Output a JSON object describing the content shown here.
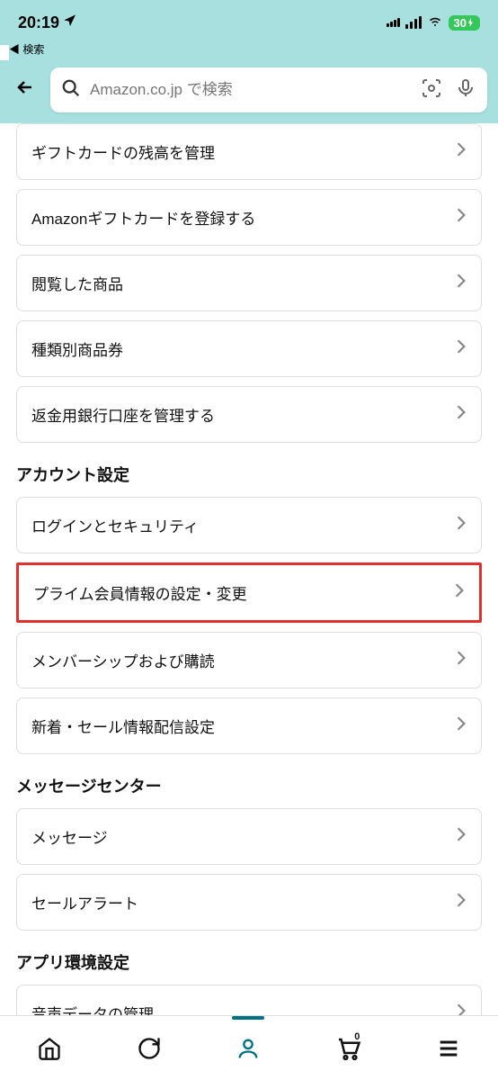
{
  "status_bar": {
    "time": "20:19",
    "back_label": "検索",
    "battery": "30"
  },
  "header": {
    "search_placeholder": "Amazon.co.jp で検索"
  },
  "sections": [
    {
      "title": "",
      "items": [
        {
          "label": "ギフトカードの残高を管理",
          "highlighted": false
        },
        {
          "label": "Amazonギフトカードを登録する",
          "highlighted": false
        },
        {
          "label": "閲覧した商品",
          "highlighted": false
        },
        {
          "label": "種類別商品券",
          "highlighted": false
        },
        {
          "label": "返金用銀行口座を管理する",
          "highlighted": false
        }
      ]
    },
    {
      "title": "アカウント設定",
      "items": [
        {
          "label": "ログインとセキュリティ",
          "highlighted": false
        },
        {
          "label": "プライム会員情報の設定・変更",
          "highlighted": true
        },
        {
          "label": "メンバーシップおよび購読",
          "highlighted": false
        },
        {
          "label": "新着・セール情報配信設定",
          "highlighted": false
        }
      ]
    },
    {
      "title": "メッセージセンター",
      "items": [
        {
          "label": "メッセージ",
          "highlighted": false
        },
        {
          "label": "セールアラート",
          "highlighted": false
        }
      ]
    },
    {
      "title": "アプリ環境設定",
      "items": [
        {
          "label": "音声データの管理",
          "highlighted": false
        }
      ]
    }
  ],
  "bottom_nav": {
    "cart_count": "0"
  }
}
